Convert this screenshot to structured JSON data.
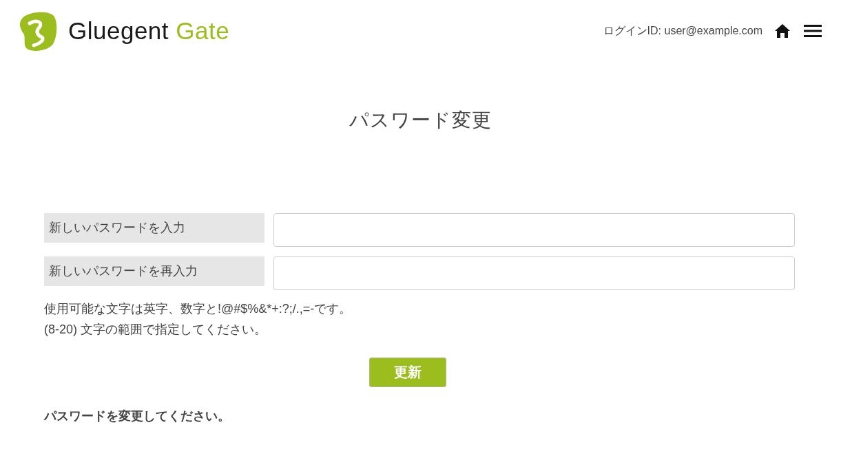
{
  "header": {
    "logo": {
      "name": "Gluegent",
      "accent": "Gate"
    },
    "login_id": "ログインID: user@example.com"
  },
  "page_title": "パスワード変更",
  "form": {
    "fields": [
      {
        "label": "新しいパスワードを入力"
      },
      {
        "label": "新しいパスワードを再入力"
      }
    ],
    "hint_lines": [
      "使用可能な文字は英字、数字と!@#$%&*+:?;/.,=-です。",
      "(8-20) 文字の範囲で指定してください。"
    ],
    "submit_button": "更新"
  },
  "message": "パスワードを変更してください。"
}
